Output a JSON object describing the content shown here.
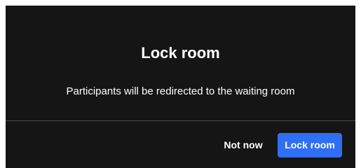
{
  "dialog": {
    "title": "Lock room",
    "message": "Participants will be redirected to the waiting room",
    "buttons": {
      "secondary_label": "Not now",
      "primary_label": "Lock room"
    }
  },
  "colors": {
    "background": "#151515",
    "primary_button": "#2f6ef5",
    "divider": "#4a4a4a",
    "text": "#ffffff"
  }
}
